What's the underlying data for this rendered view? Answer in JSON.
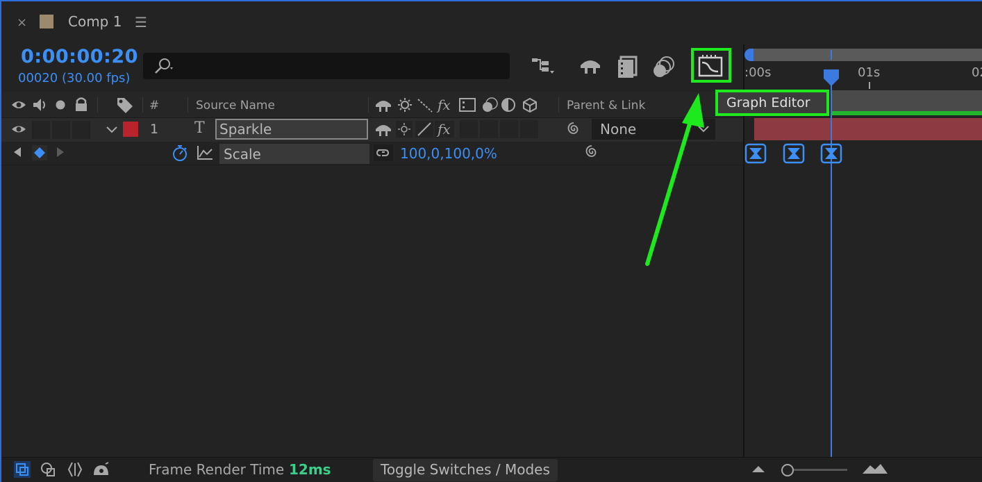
{
  "tab": {
    "close_icon": "close-icon",
    "title": "Comp 1",
    "menu_icon": "hamburger-menu-icon",
    "swatch_color": "#9c8a6c"
  },
  "timecode": {
    "current": "0:00:00:20",
    "frames": "00020 (30.00 fps)"
  },
  "search": {
    "placeholder": "",
    "icon": "search-icon"
  },
  "toolbar": {
    "buttons": [
      "composition-flowchart-icon",
      "draft-3d-icon",
      "frame-blending-icon",
      "motion-blur-icon",
      "graph-editor-icon"
    ],
    "highlighted": "graph-editor-icon"
  },
  "columns": {
    "number": "#",
    "source_name": "Source Name",
    "parent_link": "Parent & Link"
  },
  "layers": [
    {
      "number": "1",
      "type_icon": "T",
      "name": "Sparkle",
      "label_color": "#b8232c",
      "parent": "None"
    }
  ],
  "property": {
    "name": "Scale",
    "value": "100,0,100,0%"
  },
  "timeline": {
    "ticks": [
      ":00s",
      "01s",
      "02"
    ],
    "tooltip": "Graph Editor",
    "keyframes": 3,
    "current_time_seconds": 0.667
  },
  "status": {
    "frame_render_label": "Frame Render Time",
    "frame_render_value": "12ms",
    "toggle_label": "Toggle Switches / Modes"
  },
  "colors": {
    "accent_blue": "#3c8ff5",
    "highlight_green": "#1ee81e",
    "render_time_green": "#3ccf8c"
  }
}
